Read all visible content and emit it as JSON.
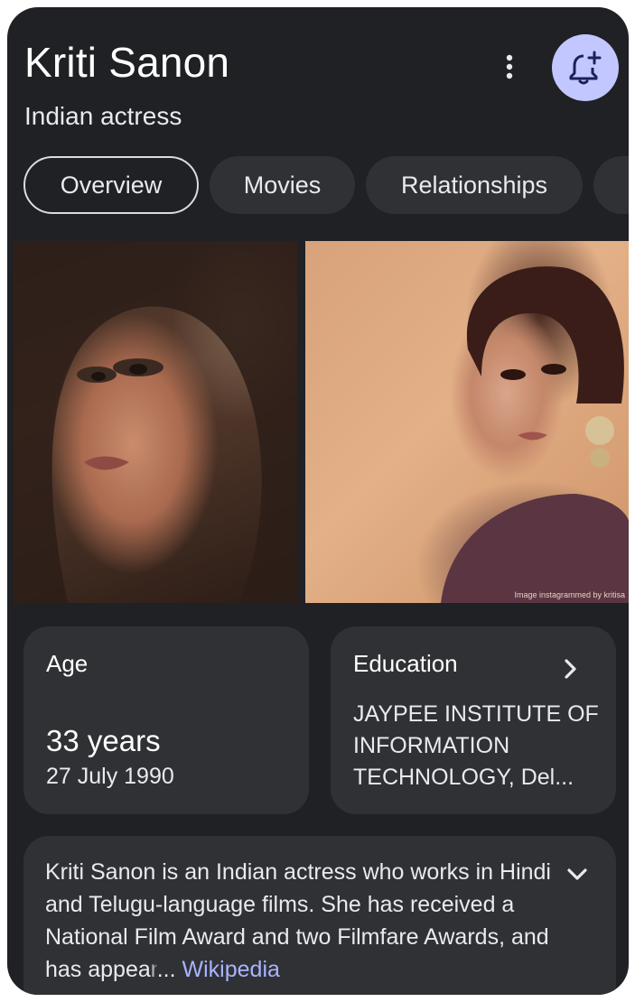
{
  "header": {
    "title": "Kriti Sanon",
    "subtitle": "Indian actress",
    "more_icon": "more-vertical-icon",
    "notification_icon": "bell-plus-icon"
  },
  "tabs": [
    {
      "label": "Overview",
      "active": true
    },
    {
      "label": "Movies",
      "active": false
    },
    {
      "label": "Relationships",
      "active": false
    }
  ],
  "images": {
    "caption": "Image instagrammed by kritisa"
  },
  "age": {
    "label": "Age",
    "value": "33 years",
    "date": "27 July 1990"
  },
  "education": {
    "label": "Education",
    "value": "JAYPEE INSTITUTE OF INFORMATION TECHNOLOGY, Del...",
    "chevron_icon": "chevron-right-icon"
  },
  "description": {
    "text": "Kriti Sanon is an Indian actress who works in Hindi and Telugu-language films. She has received a National Film Award and two Filmfare Awards, and has appea",
    "faded": "r",
    "ellipsis": "...",
    "source": "Wikipedia",
    "expand_icon": "chevron-down-icon"
  },
  "colors": {
    "background": "#202124",
    "chip": "#303134",
    "accent": "#c2c7ff",
    "link": "#a8b4ff"
  }
}
